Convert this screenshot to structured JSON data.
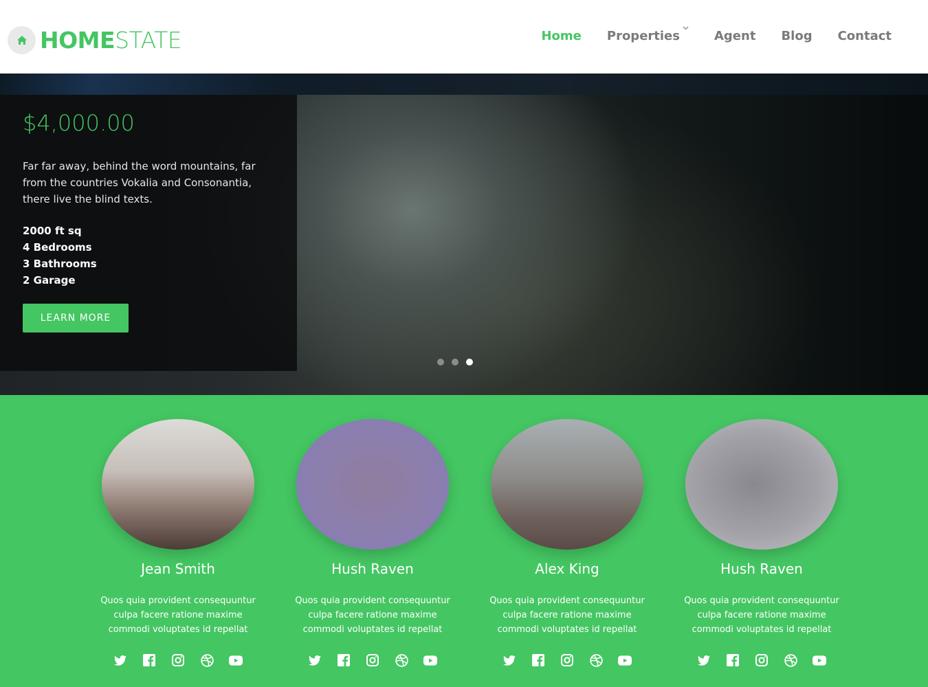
{
  "brand": {
    "name_bold": "HOME",
    "name_light": "STATE",
    "accent": "#44c662"
  },
  "nav": {
    "items": [
      {
        "label": "Home",
        "active": true
      },
      {
        "label": "Properties",
        "has_dropdown": true
      },
      {
        "label": "Agent"
      },
      {
        "label": "Blog"
      },
      {
        "label": "Contact"
      }
    ]
  },
  "hero": {
    "price": "$4,000.00",
    "description": "Far far away, behind the word mountains, far from the countries Vokalia and Consonantia, there live the blind texts.",
    "specs": [
      "2000 ft sq",
      "4 Bedrooms",
      "3 Bathrooms",
      "2 Garage"
    ],
    "cta_label": "LEARN MORE",
    "slides_total": 3,
    "active_slide": 3
  },
  "agents": [
    {
      "name": "Jean Smith",
      "bio": "Quos quia provident consequuntur culpa facere ratione maxime commodi voluptates id repellat",
      "avatar_colors": [
        "#dcdcd8",
        "#8a776e",
        "#4b3c36"
      ]
    },
    {
      "name": "Hush Raven",
      "bio": "Quos quia provident consequuntur culpa facere ratione maxime commodi voluptates id repellat",
      "avatar_colors": [
        "#8e7fb8",
        "#8c7f9e",
        "#8a7a96"
      ]
    },
    {
      "name": "Alex King",
      "bio": "Quos quia provident consequuntur culpa facere ratione maxime commodi voluptates id repellat",
      "avatar_colors": [
        "#b2b6b8",
        "#7b7370",
        "#5a4a46"
      ]
    },
    {
      "name": "Hush Raven",
      "bio": "Quos quia provident consequuntur culpa facere ratione maxime commodi voluptates id repellat",
      "avatar_colors": [
        "#c4c4c8",
        "#8a8a90",
        "#b6b6ba"
      ]
    }
  ],
  "social_icons": [
    "twitter-icon",
    "facebook-icon",
    "instagram-icon",
    "dribbble-icon",
    "youtube-icon"
  ]
}
